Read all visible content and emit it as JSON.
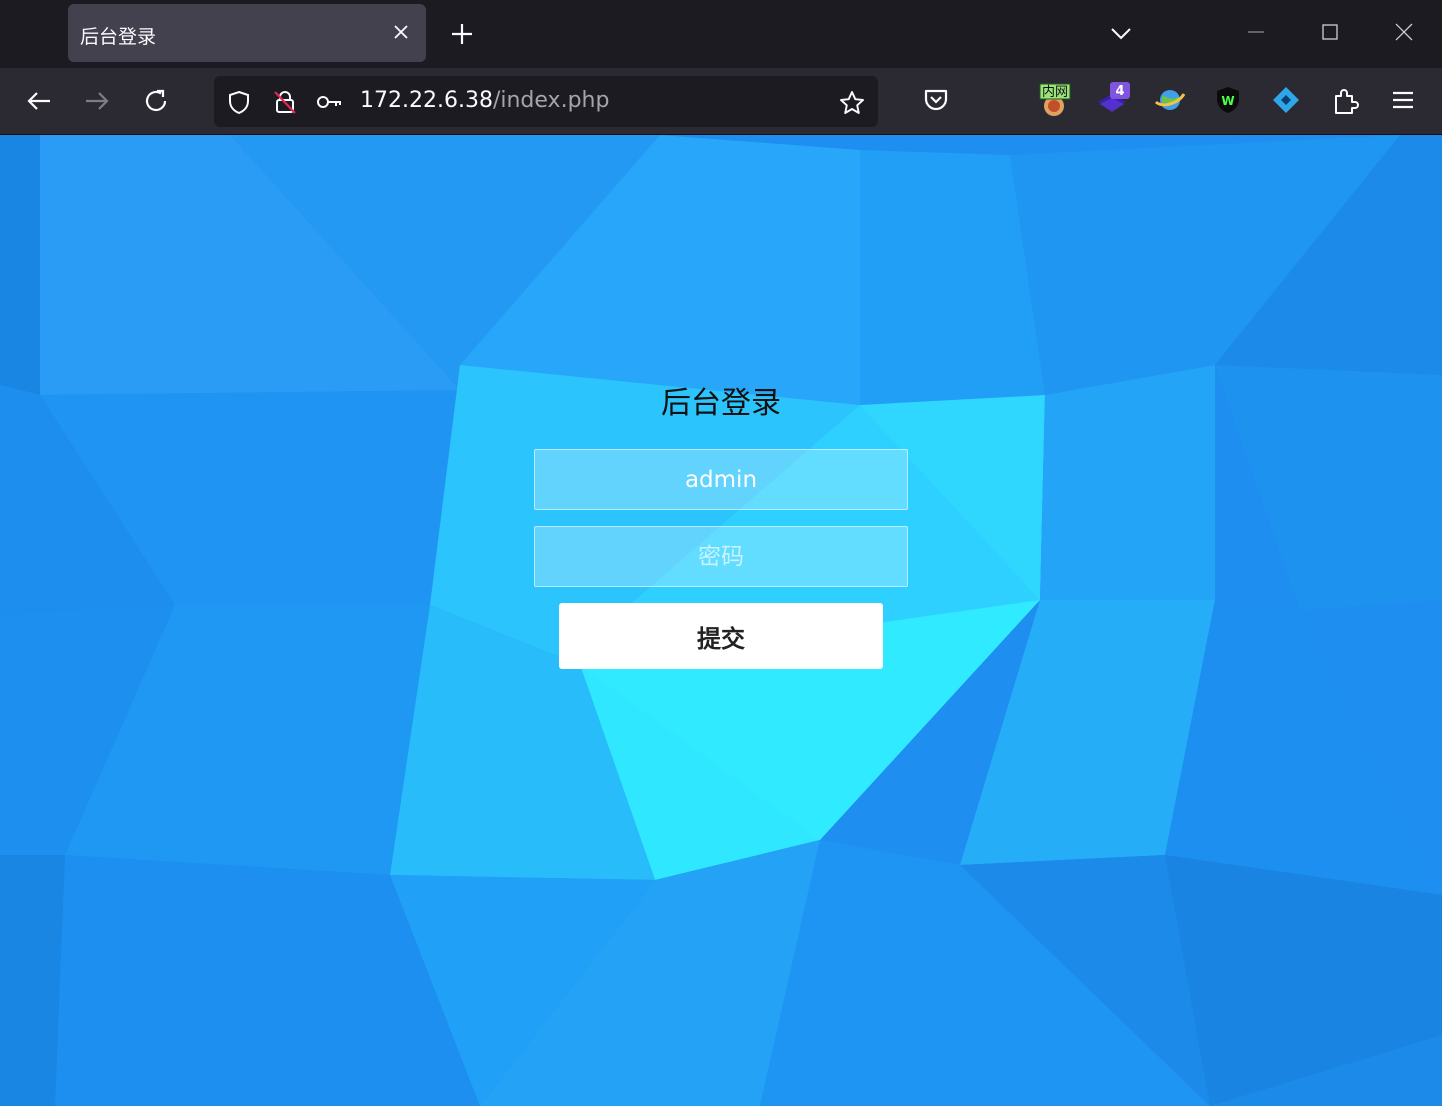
{
  "browser": {
    "tab": {
      "title": "后台登录"
    },
    "url": {
      "host": "172.22.6.38",
      "path": "/index.php"
    },
    "extensions": [
      {
        "icon": "intranet-extension-icon",
        "label": "内网"
      },
      {
        "icon": "stack-extension-icon",
        "badge": "4"
      },
      {
        "icon": "earth-extension-icon"
      },
      {
        "icon": "shield-w-extension-icon",
        "label": "W"
      },
      {
        "icon": "wappalyzer-extension-icon"
      }
    ]
  },
  "page": {
    "title": "后台登录",
    "username": {
      "value": "admin"
    },
    "password": {
      "placeholder": "密码"
    },
    "submit_label": "提交"
  },
  "colors": {
    "background_primary": "#1e8ff0",
    "background_highlight": "#2ef6ff",
    "button_bg": "#ffffff",
    "browser_chrome": "#2b2a33"
  }
}
